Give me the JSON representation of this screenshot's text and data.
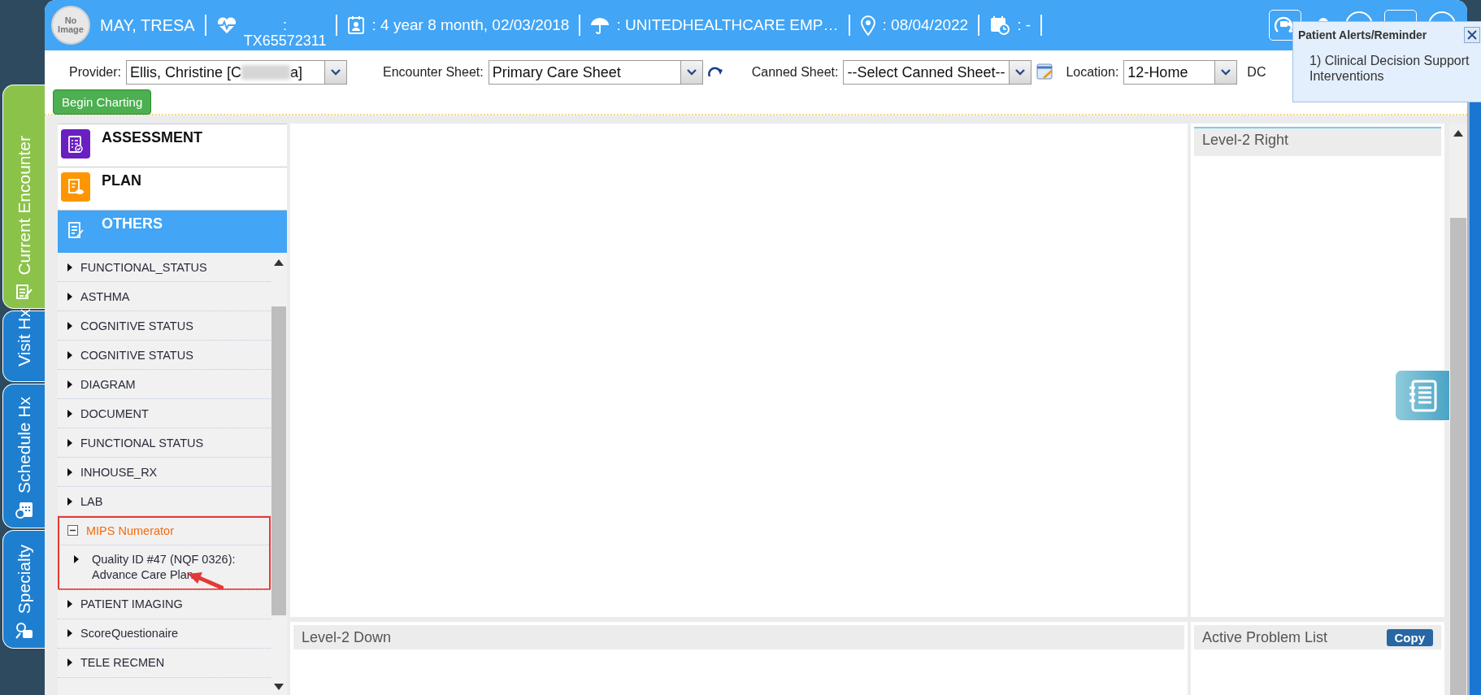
{
  "patient": {
    "photo_label": "No Image",
    "name": "MAY, TRESA",
    "id_prefix": ":",
    "id": "TX65572311",
    "age_dob": ": 4 year 8 month, 02/03/2018",
    "insurance": ": UNITEDHEALTHCARE EMP…",
    "date": ": 08/04/2022",
    "appointment": ": -"
  },
  "side_tabs": [
    {
      "label": "Current Encounter",
      "selected": true,
      "kind": "encounter"
    },
    {
      "label": "Visit Hx",
      "selected": false,
      "kind": "visit"
    },
    {
      "label": "Schedule Hx",
      "selected": false,
      "kind": "schedule"
    },
    {
      "label": "Specialty",
      "selected": false,
      "kind": "specialty"
    }
  ],
  "toolbar": {
    "provider": {
      "label": "Provider:",
      "value_start": "Ellis, Christine [C",
      "value_end": "a]"
    },
    "encounter_sheet": {
      "label": "Encounter Sheet:",
      "value": "Primary Care Sheet"
    },
    "canned_sheet": {
      "label": "Canned Sheet:",
      "value": "--Select Canned Sheet--"
    },
    "location": {
      "label": "Location:",
      "value": "12-Home"
    },
    "cut_label": "DC"
  },
  "begin_button": "Begin Charting",
  "alert": {
    "title": "Patient Alerts/Reminder",
    "items": [
      "1) Clinical Decision Support Interventions"
    ]
  },
  "categories": [
    {
      "label": "ASSESSMENT",
      "kind": "assessment",
      "color": "#6a1fc2",
      "selected": false
    },
    {
      "label": "PLAN",
      "kind": "plan",
      "color": "#ff9500",
      "selected": false
    },
    {
      "label": "OTHERS",
      "kind": "others",
      "color": "#42a5f5",
      "selected": true
    }
  ],
  "tree": [
    {
      "label": "FUNCTIONAL_STATUS",
      "expanded": false,
      "highlighted": false
    },
    {
      "label": "ASTHMA",
      "expanded": false,
      "highlighted": false
    },
    {
      "label": "COGNITIVE STATUS",
      "expanded": false,
      "highlighted": false
    },
    {
      "label": "COGNITIVE STATUS",
      "expanded": false,
      "highlighted": false
    },
    {
      "label": "DIAGRAM",
      "expanded": false,
      "highlighted": false
    },
    {
      "label": "DOCUMENT",
      "expanded": false,
      "highlighted": false
    },
    {
      "label": "FUNCTIONAL STATUS",
      "expanded": false,
      "highlighted": false
    },
    {
      "label": "INHOUSE_RX",
      "expanded": false,
      "highlighted": false
    },
    {
      "label": "LAB",
      "expanded": false,
      "highlighted": false
    },
    {
      "label": "MIPS Numerator",
      "expanded": true,
      "highlighted": true,
      "children": [
        {
          "label": "Quality ID #47 (NQF 0326): Advance Care Plan",
          "expanded": false,
          "highlighted": false
        }
      ]
    },
    {
      "label": "PATIENT IMAGING",
      "expanded": false,
      "highlighted": false
    },
    {
      "label": "ScoreQuestionaire",
      "expanded": false,
      "highlighted": false
    },
    {
      "label": "TELE RECMEN",
      "expanded": false,
      "highlighted": false
    }
  ],
  "panels": {
    "down": {
      "title": "Level-2 Down"
    },
    "right": {
      "title": "Level-2 Right"
    },
    "problems": {
      "title": "Active Problem List",
      "button": "Copy"
    }
  }
}
